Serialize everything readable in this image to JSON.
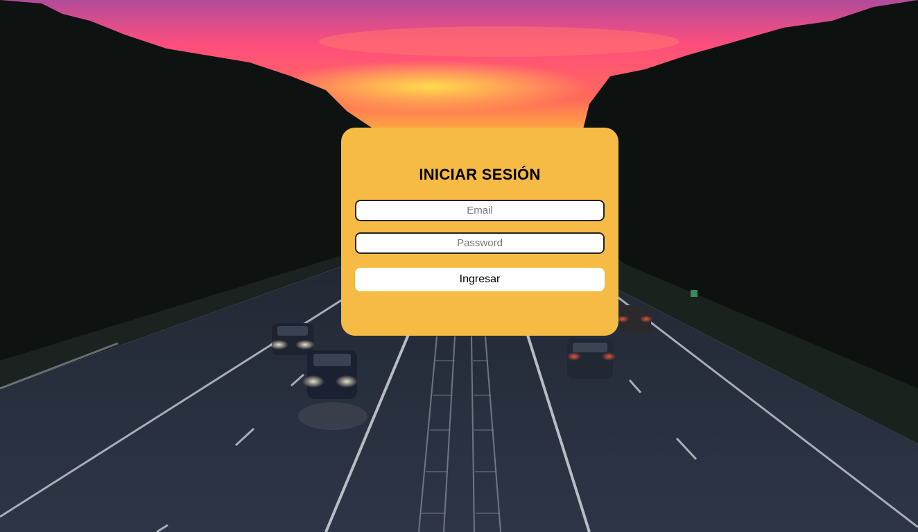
{
  "theme": {
    "card_color": "#f5bb45",
    "sky_top": "#a44a9a",
    "sky_mid": "#ff4d7a",
    "sky_glow": "#ffd04a",
    "forest": "#0f1312",
    "road": "#2a3140"
  },
  "login": {
    "title": "INICIAR SESIÓN",
    "email_placeholder": "Email",
    "password_placeholder": "Password",
    "submit_label": "Ingresar"
  }
}
